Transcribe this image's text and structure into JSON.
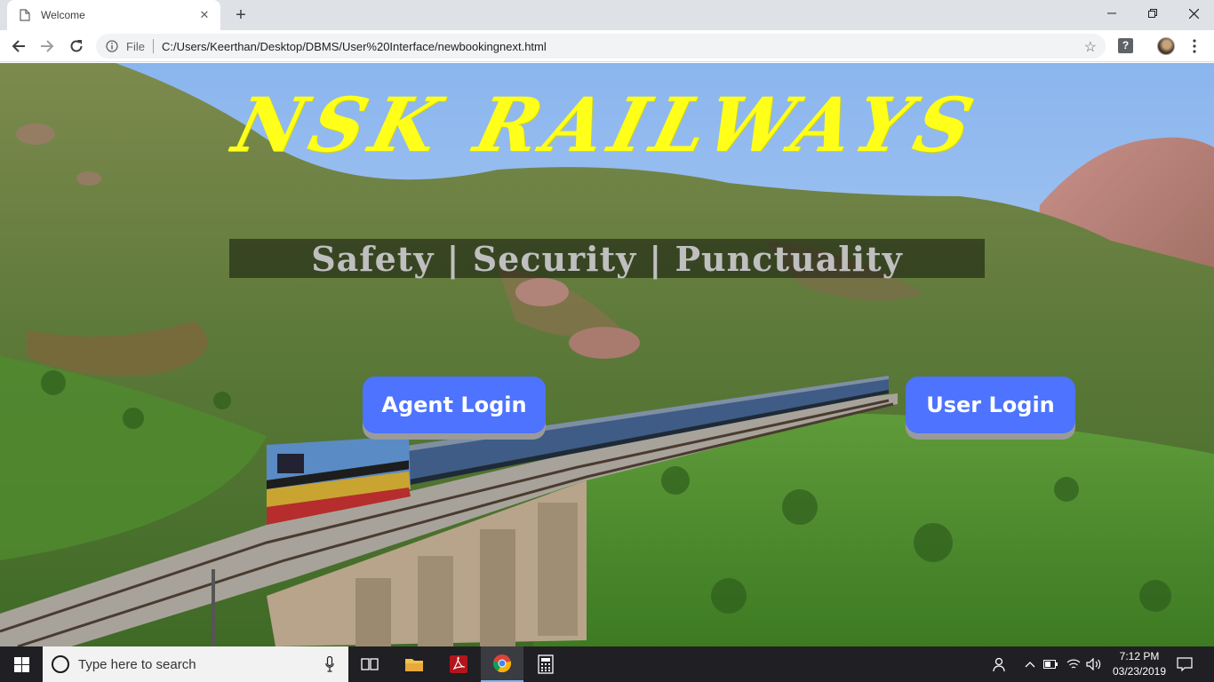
{
  "browser": {
    "tab_title": "Welcome",
    "tab_close": "✕",
    "new_tab": "+",
    "file_label": "File",
    "url": "C:/Users/Keerthan/Desktop/DBMS/User%20Interface/newbookingnext.html",
    "star": "☆",
    "help": "?"
  },
  "page": {
    "brand": "NSK RAILWAYS",
    "tagline": "Safety | Security | Punctuality",
    "agent_login": "Agent Login",
    "user_login": "User Login"
  },
  "taskbar": {
    "search_placeholder": "Type here to search",
    "time": "7:12 PM",
    "date": "03/23/2019"
  },
  "colors": {
    "brand": "#ffff1a",
    "button": "#4d73ff",
    "sky": "#8fb8ee"
  }
}
